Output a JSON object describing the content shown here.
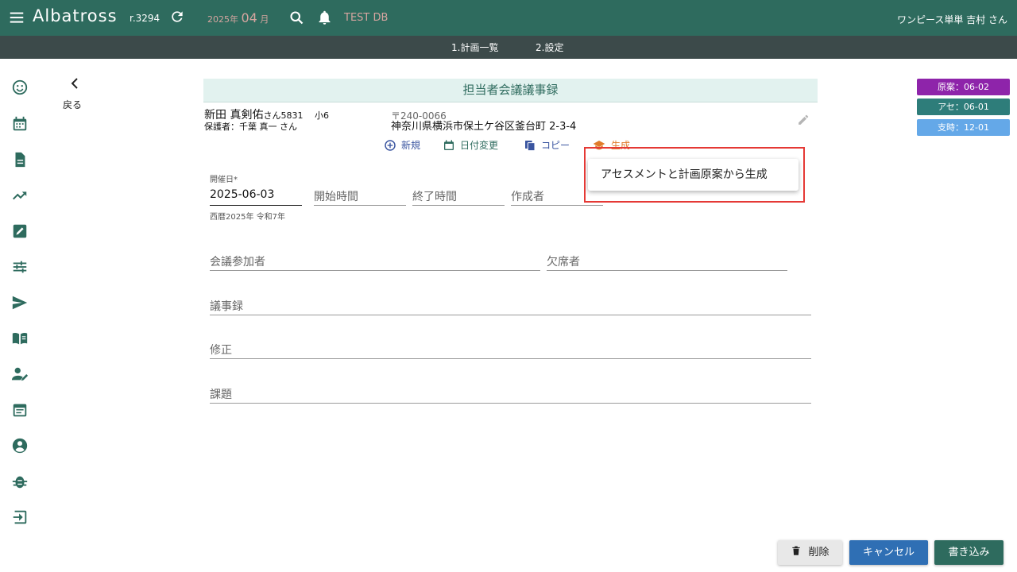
{
  "header": {
    "app_title": "Albatross",
    "revision": "r.3294",
    "year": "2025",
    "year_unit": "年",
    "month": "04",
    "month_unit": "月",
    "db_label": "TEST DB",
    "user_name": "ワンピース単単 吉村 さん",
    "accent_color": "#2e6b5e"
  },
  "subnav": {
    "tabs": [
      {
        "label": "1.計画一覧"
      },
      {
        "label": "2.設定"
      }
    ]
  },
  "sidebar": {
    "icons": [
      "smile-icon",
      "calendar-icon",
      "document-icon",
      "trending-up-icon",
      "edit-note-icon",
      "tune-icon",
      "send-icon",
      "book-icon",
      "user-edit-icon",
      "event-note-icon",
      "account-circle-icon",
      "bug-icon",
      "exit-icon"
    ]
  },
  "back": {
    "label": "戻る"
  },
  "card": {
    "title": "担当者会議議事録",
    "client_name": "新田 真剣佑",
    "client_suffix": "さん5831",
    "client_grade": "小6",
    "guardian": "保護者：千葉 真一 さん",
    "postal": "〒240-0066",
    "address": "神奈川県横浜市保土ケ谷区釜台町 2-3-4"
  },
  "actions": {
    "new_label": "新規",
    "date_change_label": "日付変更",
    "copy_label": "コピー",
    "generate_label": "生成"
  },
  "form": {
    "date_label": "開催日*",
    "date_value": "2025-06-03",
    "date_hint": "西暦2025年 令和7年",
    "start_time_placeholder": "開始時間",
    "end_time_placeholder": "終了時間",
    "author_placeholder": "作成者",
    "participants_placeholder": "会議参加者",
    "absentees_placeholder": "欠席者",
    "minutes_placeholder": "議事録",
    "revision_placeholder": "修正",
    "issues_placeholder": "課題"
  },
  "badges": [
    {
      "label": "原案：06-02",
      "color": "#8e24aa"
    },
    {
      "label": "アセ：06-01",
      "color": "#2e7d7a"
    },
    {
      "label": "支時：12-01",
      "color": "#64a8e8"
    }
  ],
  "popup": {
    "item_label": "アセスメントと計画原案から生成"
  },
  "buttons": {
    "delete_label": "削除",
    "cancel_label": "キャンセル",
    "save_label": "書き込み"
  }
}
